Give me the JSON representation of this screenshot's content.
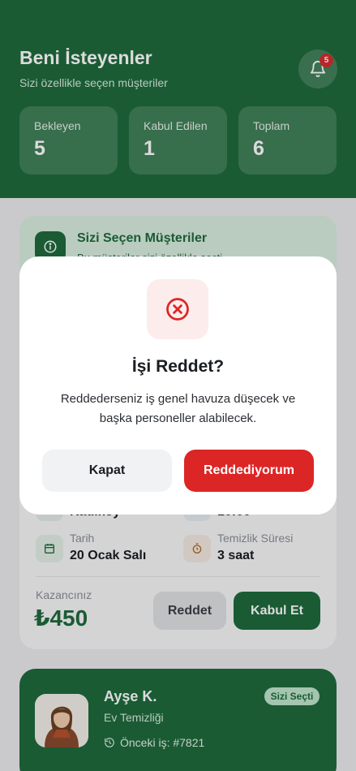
{
  "header": {
    "title": "Beni İsteyenler",
    "subtitle": "Sizi özellikle seçen müşteriler",
    "notification_count": "5",
    "stats": [
      {
        "label": "Bekleyen",
        "value": "5"
      },
      {
        "label": "Kabul Edilen",
        "value": "1"
      },
      {
        "label": "Toplam",
        "value": "6"
      }
    ]
  },
  "info_card": {
    "title": "Sizi Seçen Müşteriler",
    "description": "Bu müşteriler sizi özellikle seçti"
  },
  "job_card": {
    "location_value": "Kadıköy",
    "time_value": "10:00",
    "date_label": "Tarih",
    "date_value": "20 Ocak Salı",
    "duration_label": "Temizlik Süresi",
    "duration_value": "3 saat",
    "earnings_label": "Kazancınız",
    "earnings_value": "₺450",
    "reject_label": "Reddet",
    "accept_label": "Kabul Et"
  },
  "customer_card": {
    "name": "Ayşe K.",
    "service": "Ev Temizliği",
    "previous_job": "Önceki iş: #7821",
    "badge": "Sizi Seçti"
  },
  "modal": {
    "title": "İşi Reddet?",
    "message": "Reddederseniz iş genel havuza düşecek ve başka personeller alabilecek.",
    "close_label": "Kapat",
    "confirm_label": "Reddediyorum",
    "icon": "x-circle-icon"
  },
  "colors": {
    "primary": "#1f6b3d",
    "danger": "#dc2626",
    "background": "#ececee"
  }
}
